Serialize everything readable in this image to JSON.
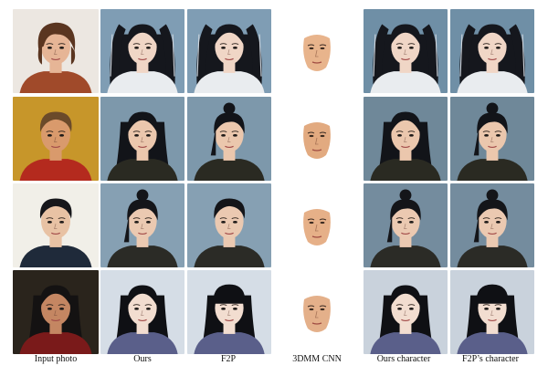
{
  "figure": {
    "columns": [
      {
        "key": "input",
        "caption": "Input photo"
      },
      {
        "key": "ours",
        "caption": "Ours"
      },
      {
        "key": "f2p",
        "caption": "F2P"
      },
      {
        "key": "cnn3dmm",
        "caption": "3DMM CNN"
      },
      {
        "key": "ours_char",
        "caption": "Ours character"
      },
      {
        "key": "f2p_char",
        "caption": "F2P’s character"
      }
    ],
    "rows": [
      {
        "input": {
          "bg": "#ece7e1",
          "skin": "#e6b596",
          "hair": "#5a3520",
          "cloth": "#a04a2a",
          "style": "bob"
        },
        "ours": {
          "bg": "#7f9db4",
          "skin": "#f0d6c6",
          "hair": "#15171d",
          "cloth": "#e9ecef",
          "style": "twintail"
        },
        "f2p": {
          "bg": "#7f9db4",
          "skin": "#f0d6c6",
          "hair": "#15171d",
          "cloth": "#e9ecef",
          "style": "twintail"
        },
        "cnn": {
          "skin": "#e8b48c"
        },
        "ours_char": {
          "bg": "#6f8fa6",
          "skin": "#f0d6c6",
          "hair": "#15171d",
          "cloth": "#e9ecef",
          "style": "twintail"
        },
        "f2p_char": {
          "bg": "#6f8fa6",
          "skin": "#f0d6c6",
          "hair": "#15171d",
          "cloth": "#e9ecef",
          "style": "twintail"
        }
      },
      {
        "input": {
          "bg": "#c7962a",
          "skin": "#d99a6c",
          "hair": "#6b4a2a",
          "cloth": "#b42a1e",
          "style": "short"
        },
        "ours": {
          "bg": "#7d98ab",
          "skin": "#ebc7ad",
          "hair": "#121419",
          "cloth": "#2a2a22",
          "style": "long"
        },
        "f2p": {
          "bg": "#7d98ab",
          "skin": "#ebc7ad",
          "hair": "#121419",
          "cloth": "#2a2a22",
          "style": "bun"
        },
        "cnn": {
          "skin": "#e2aa80"
        },
        "ours_char": {
          "bg": "#6f8899",
          "skin": "#ebc7ad",
          "hair": "#121419",
          "cloth": "#2a2a22",
          "style": "long"
        },
        "f2p_char": {
          "bg": "#6f8899",
          "skin": "#ebc7ad",
          "hair": "#121419",
          "cloth": "#2a2a22",
          "style": "bun"
        }
      },
      {
        "input": {
          "bg": "#f1efe8",
          "skin": "#e8c2a4",
          "hair": "#16161a",
          "cloth": "#1f2a3a",
          "style": "short"
        },
        "ours": {
          "bg": "#86a0b3",
          "skin": "#ebc9b1",
          "hair": "#141519",
          "cloth": "#2b2b26",
          "style": "bun"
        },
        "f2p": {
          "bg": "#86a0b3",
          "skin": "#ebc9b1",
          "hair": "#141519",
          "cloth": "#2b2b26",
          "style": "short"
        },
        "cnn": {
          "skin": "#e6b088"
        },
        "ours_char": {
          "bg": "#748c9e",
          "skin": "#ebc9b1",
          "hair": "#141519",
          "cloth": "#2b2b26",
          "style": "bun"
        },
        "f2p_char": {
          "bg": "#748c9e",
          "skin": "#ebc9b1",
          "hair": "#141519",
          "cloth": "#2b2b26",
          "style": "bun"
        }
      },
      {
        "input": {
          "bg": "#2a241c",
          "skin": "#c48662",
          "hair": "#141212",
          "cloth": "#7a1a1a",
          "style": "long"
        },
        "ours": {
          "bg": "#d5dde6",
          "skin": "#f2ddd0",
          "hair": "#0f1014",
          "cloth": "#5a5f8a",
          "style": "long"
        },
        "f2p": {
          "bg": "#d5dde6",
          "skin": "#f2ddd0",
          "hair": "#0f1014",
          "cloth": "#5a5f8a",
          "style": "bangs"
        },
        "cnn": {
          "skin": "#e4b08a"
        },
        "ours_char": {
          "bg": "#c9d2dc",
          "skin": "#f2ddd0",
          "hair": "#0f1014",
          "cloth": "#5a5f8a",
          "style": "long"
        },
        "f2p_char": {
          "bg": "#c9d2dc",
          "skin": "#f2ddd0",
          "hair": "#0f1014",
          "cloth": "#5a5f8a",
          "style": "bangs"
        }
      }
    ]
  }
}
